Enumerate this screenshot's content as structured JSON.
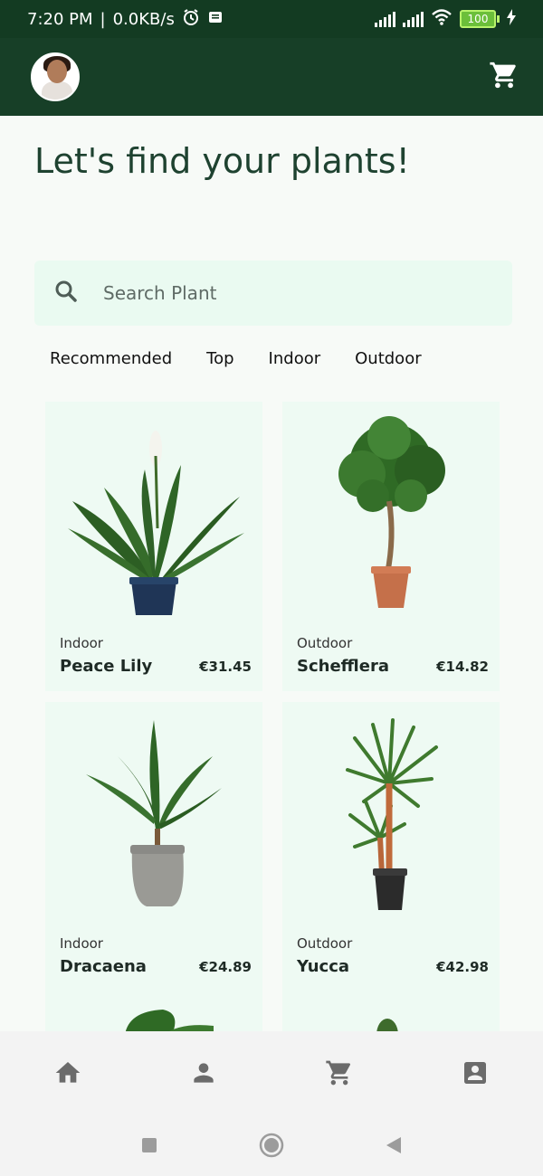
{
  "status_bar": {
    "time": "7:20 PM",
    "speed": "0.0KB/s",
    "battery": "100"
  },
  "app_bar": {
    "avatar_icon": "avatar-photo",
    "cart_icon": "cart-icon"
  },
  "headline": "Let's find your plants!",
  "search": {
    "placeholder": "Search Plant",
    "icon": "search-icon"
  },
  "tabs": [
    "Recommended",
    "Top",
    "Indoor",
    "Outdoor"
  ],
  "products": [
    {
      "category": "Indoor",
      "name": "Peace Lily",
      "price": "€31.45",
      "icon": "peace-lily-plant"
    },
    {
      "category": "Outdoor",
      "name": "Schefflera",
      "price": "€14.82",
      "icon": "schefflera-plant"
    },
    {
      "category": "Indoor",
      "name": "Dracaena",
      "price": "€24.89",
      "icon": "dracaena-plant"
    },
    {
      "category": "Outdoor",
      "name": "Yucca",
      "price": "€42.98",
      "icon": "yucca-plant"
    }
  ],
  "bottom_nav": [
    "home-icon",
    "person-icon",
    "cart-icon",
    "account-box-icon"
  ],
  "colors": {
    "primary_dark": "#133b22",
    "app_bar": "#173f27",
    "card_bg": "#eefaf3",
    "headline": "#1e4230"
  }
}
